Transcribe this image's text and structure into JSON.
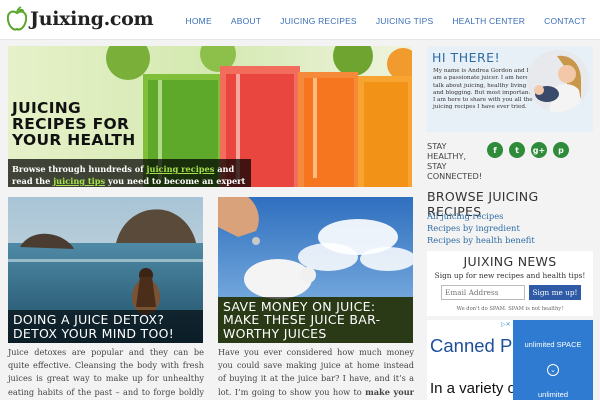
{
  "header": {
    "logo_text": "Juixing.com",
    "nav": [
      "HOME",
      "ABOUT",
      "JUICING RECIPES",
      "JUICING TIPS",
      "HEALTH CENTER",
      "CONTACT"
    ]
  },
  "hero": {
    "title": "JUICING RECIPES FOR YOUR HEALTH",
    "caption_pre": "Browse through hundreds of ",
    "caption_link1": "juicing recipes",
    "caption_mid": " and read the ",
    "caption_link2": "juicing tips",
    "caption_post": " you need to become an expert juicer."
  },
  "articles": [
    {
      "title": "DOING A JUICE DETOX? DETOX YOUR MIND TOO!",
      "excerpt": "Juice detoxes are popular and they can be quite effective. Cleansing the body with fresh juices is great way to make up for unhealthy eating habits of the past – and to forge boldly into a healthy future."
    },
    {
      "title": "SAVE MONEY ON JUICE: MAKE THESE JUICE BAR-WORTHY JUICES",
      "excerpt_pre": "Have you ever considered how much money you could save making juice at home instead of buying it at the juice bar? I have, and it’s a lot. I’m going to show you how to ",
      "excerpt_bold": "make your own juice bar-"
    }
  ],
  "sidebar": {
    "hi_title": "HI THERE!",
    "hi_text": "My name is Andrea Gordon and I am a passionate juicer. I am here to talk about juicing, healthy living and blogging. But most importantly, I am here to share with you all the juicing recipes I have ever tried.",
    "stay_text": "STAY HEALTHY, STAY CONNECTED!",
    "socials": [
      {
        "icon": "facebook-icon",
        "glyph": "f"
      },
      {
        "icon": "twitter-icon",
        "glyph": "t"
      },
      {
        "icon": "google-plus-icon",
        "glyph": "g+"
      },
      {
        "icon": "pinterest-icon",
        "glyph": "p"
      }
    ],
    "social_color": "#2e8b3a",
    "browse_title": "BROWSE JUICING RECIPES",
    "browse_links": [
      "All juicing recipes",
      "Recipes by ingredient",
      "Recipes by health benefit"
    ],
    "news_title": "JUIXING NEWS",
    "news_sub": "Sign up for new recipes and health tips!",
    "email_placeholder": "Email Address",
    "signup_label": "Sign me up!",
    "nospam": "We don't do SPAM. SPAM is not healthy!"
  },
  "ad": {
    "headline": "Canned Peaches",
    "sub": "In a variety of grades",
    "blue_text": "unlimited SPACE",
    "blue_text2": "unlimited",
    "badge": "▷✕"
  }
}
